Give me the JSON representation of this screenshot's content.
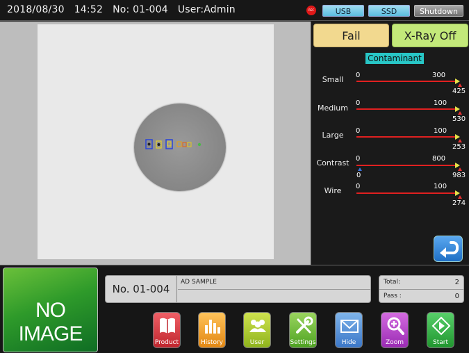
{
  "status_bar": {
    "date": "2018/08/30",
    "time": "14:52",
    "product_no": "No: 01-004",
    "user": "User:Admin",
    "rec_label": "REC",
    "usb_label": "USB",
    "ssd_label": "SSD",
    "shutdown_label": "Shutdown"
  },
  "result": {
    "fail_label": "Fail",
    "xray_label": "X-Ray Off"
  },
  "contaminant": {
    "title": "Contaminant",
    "rows": [
      {
        "label": "Small",
        "min": "0",
        "threshold": "300",
        "value": "425"
      },
      {
        "label": "Medium",
        "min": "0",
        "threshold": "100",
        "value": "530"
      },
      {
        "label": "Large",
        "min": "0",
        "threshold": "100",
        "value": "253"
      },
      {
        "label": "Contrast",
        "min": "0",
        "threshold": "800",
        "low_value": "0",
        "value": "983"
      },
      {
        "label": "Wire",
        "min": "0",
        "threshold": "100",
        "value": "274"
      }
    ]
  },
  "preview": {
    "no_image_label": "NO IMAGE"
  },
  "product": {
    "number": "No. 01-004",
    "name": "AD SAMPLE"
  },
  "counts": {
    "total_label": "Total:",
    "total_value": "2",
    "pass_label": "Pass :",
    "pass_value": "0"
  },
  "nav": {
    "product": "Product",
    "history": "History",
    "user": "User",
    "settings": "Settings",
    "hide": "Hide",
    "zoom": "Zoom",
    "start": "Start"
  },
  "colors": {
    "fail": "#f2d98f",
    "xray_off": "#c3e97a",
    "contaminant_header": "#28c6c6",
    "bar": "#e12020"
  }
}
